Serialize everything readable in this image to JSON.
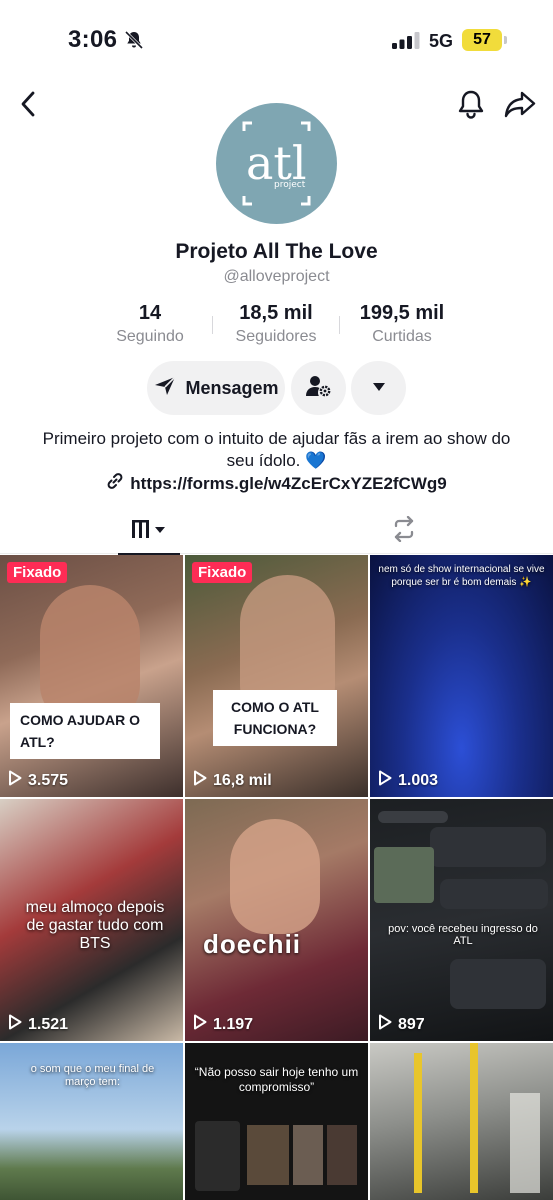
{
  "status": {
    "time": "3:06",
    "network": "5G",
    "battery": "57"
  },
  "profile": {
    "display_name": "Projeto All The Love",
    "username": "@alloveproject",
    "logo_text": "atl",
    "logo_sub": "project"
  },
  "stats": [
    {
      "value": "14",
      "label": "Seguindo"
    },
    {
      "value": "18,5 mil",
      "label": "Seguidores"
    },
    {
      "value": "199,5 mil",
      "label": "Curtidas"
    }
  ],
  "actions": {
    "message_label": "Mensagem"
  },
  "bio": {
    "text": "Primeiro projeto com o intuito de ajudar fãs a irem ao show do seu ídolo.",
    "emoji": "💙",
    "link": "https://forms.gle/w4ZcErCxYZE2fCWg9"
  },
  "videos": [
    {
      "pinned": "Fixado",
      "caption": "COMO AJUDAR O ATL?",
      "views": "3.575"
    },
    {
      "pinned": "Fixado",
      "caption": "COMO O ATL FUNCIONA?",
      "views": "16,8 mil"
    },
    {
      "caption": "nem só de show internacional se vive porque ser br é bom demais ✨",
      "views": "1.003"
    },
    {
      "caption": "meu almoço depois de gastar tudo com BTS",
      "views": "1.521"
    },
    {
      "caption": "doechii",
      "views": "1.197"
    },
    {
      "caption": "pov: você recebeu ingresso do ATL",
      "views": "897"
    },
    {
      "caption": "o som que o meu final de março tem:"
    },
    {
      "caption": "“Não posso sair hoje tenho um compromisso”"
    },
    {
      "caption": ""
    }
  ],
  "colors": {
    "pinned": "#fe2c55",
    "avatar_bg": "#7fa6b2",
    "button_bg": "#f1f1f2"
  }
}
